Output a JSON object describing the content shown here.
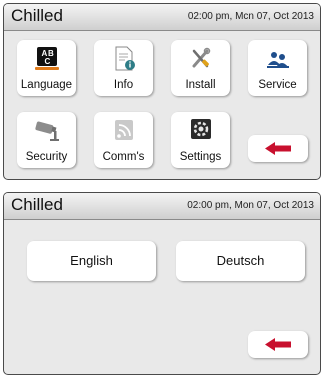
{
  "menu_screen": {
    "title": "Chilled",
    "datetime": "02:00 pm, Mcn 07, Oct 2013",
    "tiles": [
      {
        "label": "Language",
        "icon": "language-icon"
      },
      {
        "label": "Info",
        "icon": "info-document-icon"
      },
      {
        "label": "Install",
        "icon": "tools-icon"
      },
      {
        "label": "Service",
        "icon": "service-people-icon"
      },
      {
        "label": "Security",
        "icon": "security-camera-icon"
      },
      {
        "label": "Comm's",
        "icon": "comms-signal-icon"
      },
      {
        "label": "Settings",
        "icon": "settings-gear-icon"
      }
    ],
    "back_icon": "back-arrow-icon"
  },
  "language_screen": {
    "title": "Chilled",
    "datetime": "02:00 pm, Mon 07, Oct 2013",
    "options": [
      "English",
      "Deutsch"
    ],
    "back_icon": "back-arrow-icon"
  },
  "colors": {
    "back_arrow": "#c8102e",
    "panel_background": "#e9e9e9",
    "tile_background": "#ffffff"
  }
}
